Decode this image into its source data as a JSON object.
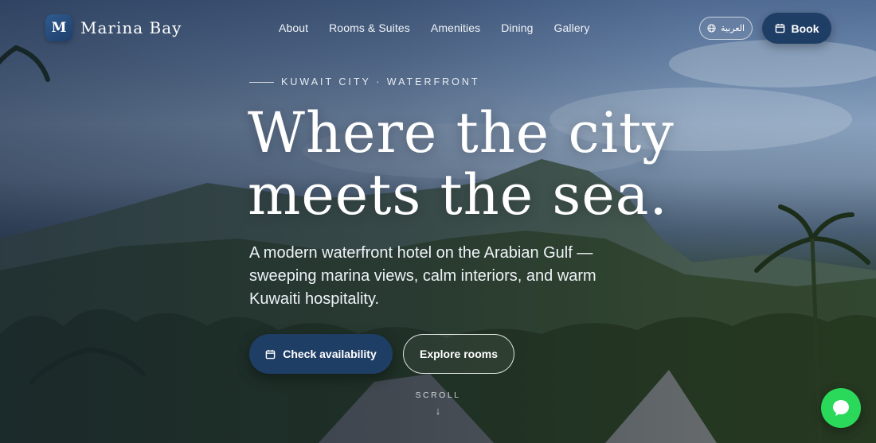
{
  "brand": {
    "mark": "M",
    "name": "Marina Bay"
  },
  "nav": {
    "items": [
      {
        "label": "About"
      },
      {
        "label": "Rooms & Suites"
      },
      {
        "label": "Amenities"
      },
      {
        "label": "Dining"
      },
      {
        "label": "Gallery"
      }
    ],
    "language_label": "العربية",
    "book_label": "Book"
  },
  "hero": {
    "eyebrow": "KUWAIT CITY · WATERFRONT",
    "headline_line1": "Where the city",
    "headline_line2": "meets the sea.",
    "lede": "A modern waterfront hotel on the Arabian Gulf — sweeping marina views, calm interiors, and warm Kuwaiti hospitality.",
    "primary_cta": "Check availability",
    "secondary_cta": "Explore rooms",
    "scroll_label": "SCROLL",
    "scroll_arrow": "↓"
  },
  "icons": {
    "globe": "globe-icon",
    "calendar": "calendar-icon",
    "chat": "chat-bubble-icon"
  },
  "colors": {
    "accent": "#1f3e66",
    "chat": "#2bd95a"
  }
}
